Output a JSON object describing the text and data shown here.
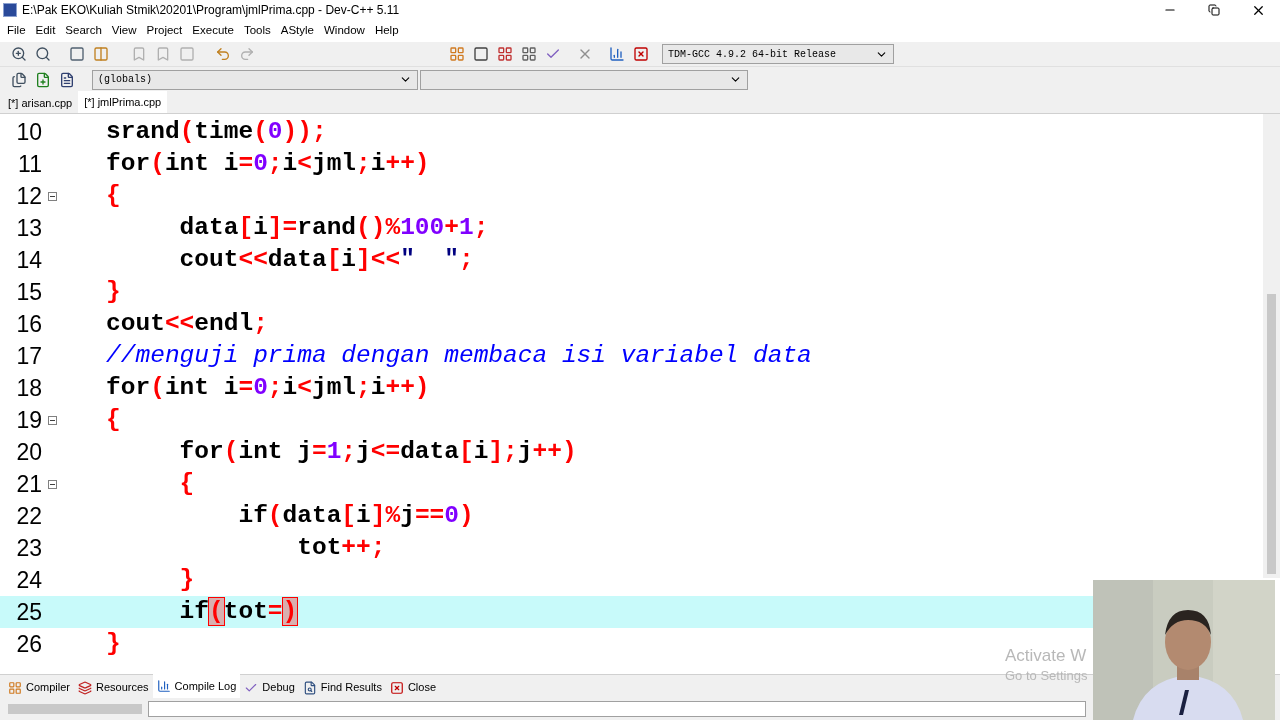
{
  "window": {
    "title": "E:\\Pak EKO\\Kuliah Stmik\\20201\\Program\\jmlPrima.cpp - Dev-C++ 5.11"
  },
  "menu": [
    "File",
    "Edit",
    "Search",
    "View",
    "Project",
    "Execute",
    "Tools",
    "AStyle",
    "Window",
    "Help"
  ],
  "compiler_select": {
    "value": "TDM-GCC 4.9.2 64-bit Release"
  },
  "scope_select": {
    "value": "(globals)"
  },
  "file_tabs": [
    {
      "label": "[*] arisan.cpp",
      "selected": false
    },
    {
      "label": "[*] jmlPrima.cpp",
      "selected": true
    }
  ],
  "editor": {
    "lines": [
      {
        "number": "10",
        "fold": false,
        "current": false,
        "tokens": [
          {
            "kind": "plain",
            "text": "   srand"
          },
          {
            "kind": "symbol",
            "text": "("
          },
          {
            "kind": "plain",
            "text": "time"
          },
          {
            "kind": "symbol",
            "text": "("
          },
          {
            "kind": "number",
            "text": "0"
          },
          {
            "kind": "symbol",
            "text": "));"
          }
        ]
      },
      {
        "number": "11",
        "fold": false,
        "current": false,
        "tokens": [
          {
            "kind": "keyword",
            "text": "   for"
          },
          {
            "kind": "symbol",
            "text": "("
          },
          {
            "kind": "keyword",
            "text": "int"
          },
          {
            "kind": "plain",
            "text": " i"
          },
          {
            "kind": "symbol",
            "text": "="
          },
          {
            "kind": "number",
            "text": "0"
          },
          {
            "kind": "symbol",
            "text": ";"
          },
          {
            "kind": "plain",
            "text": "i"
          },
          {
            "kind": "symbol",
            "text": "<"
          },
          {
            "kind": "plain",
            "text": "jml"
          },
          {
            "kind": "symbol",
            "text": ";"
          },
          {
            "kind": "plain",
            "text": "i"
          },
          {
            "kind": "symbol",
            "text": "++)"
          }
        ]
      },
      {
        "number": "12",
        "fold": true,
        "current": false,
        "tokens": [
          {
            "kind": "symbol",
            "text": "   {"
          }
        ]
      },
      {
        "number": "13",
        "fold": false,
        "current": false,
        "tokens": [
          {
            "kind": "plain",
            "text": "        data"
          },
          {
            "kind": "symbol",
            "text": "["
          },
          {
            "kind": "plain",
            "text": "i"
          },
          {
            "kind": "symbol",
            "text": "]="
          },
          {
            "kind": "plain",
            "text": "rand"
          },
          {
            "kind": "symbol",
            "text": "()%"
          },
          {
            "kind": "number",
            "text": "100"
          },
          {
            "kind": "symbol",
            "text": "+"
          },
          {
            "kind": "number",
            "text": "1"
          },
          {
            "kind": "symbol",
            "text": ";"
          }
        ]
      },
      {
        "number": "14",
        "fold": false,
        "current": false,
        "tokens": [
          {
            "kind": "plain",
            "text": "        cout"
          },
          {
            "kind": "symbol",
            "text": "<<"
          },
          {
            "kind": "plain",
            "text": "data"
          },
          {
            "kind": "symbol",
            "text": "["
          },
          {
            "kind": "plain",
            "text": "i"
          },
          {
            "kind": "symbol",
            "text": "]<<"
          },
          {
            "kind": "string",
            "text": "\"  \""
          },
          {
            "kind": "symbol",
            "text": ";"
          }
        ]
      },
      {
        "number": "15",
        "fold": false,
        "current": false,
        "tokens": [
          {
            "kind": "symbol",
            "text": "   }"
          }
        ]
      },
      {
        "number": "16",
        "fold": false,
        "current": false,
        "tokens": [
          {
            "kind": "plain",
            "text": "   cout"
          },
          {
            "kind": "symbol",
            "text": "<<"
          },
          {
            "kind": "plain",
            "text": "endl"
          },
          {
            "kind": "symbol",
            "text": ";"
          }
        ]
      },
      {
        "number": "17",
        "fold": false,
        "current": false,
        "tokens": [
          {
            "kind": "comment",
            "text": "   //menguji prima dengan membaca isi variabel data"
          }
        ]
      },
      {
        "number": "18",
        "fold": false,
        "current": false,
        "tokens": [
          {
            "kind": "keyword",
            "text": "   for"
          },
          {
            "kind": "symbol",
            "text": "("
          },
          {
            "kind": "keyword",
            "text": "int"
          },
          {
            "kind": "plain",
            "text": " i"
          },
          {
            "kind": "symbol",
            "text": "="
          },
          {
            "kind": "number",
            "text": "0"
          },
          {
            "kind": "symbol",
            "text": ";"
          },
          {
            "kind": "plain",
            "text": "i"
          },
          {
            "kind": "symbol",
            "text": "<"
          },
          {
            "kind": "plain",
            "text": "jml"
          },
          {
            "kind": "symbol",
            "text": ";"
          },
          {
            "kind": "plain",
            "text": "i"
          },
          {
            "kind": "symbol",
            "text": "++)"
          }
        ]
      },
      {
        "number": "19",
        "fold": true,
        "current": false,
        "tokens": [
          {
            "kind": "symbol",
            "text": "   {"
          }
        ]
      },
      {
        "number": "20",
        "fold": false,
        "current": false,
        "tokens": [
          {
            "kind": "keyword",
            "text": "        for"
          },
          {
            "kind": "symbol",
            "text": "("
          },
          {
            "kind": "keyword",
            "text": "int"
          },
          {
            "kind": "plain",
            "text": " j"
          },
          {
            "kind": "symbol",
            "text": "="
          },
          {
            "kind": "number",
            "text": "1"
          },
          {
            "kind": "symbol",
            "text": ";"
          },
          {
            "kind": "plain",
            "text": "j"
          },
          {
            "kind": "symbol",
            "text": "<="
          },
          {
            "kind": "plain",
            "text": "data"
          },
          {
            "kind": "symbol",
            "text": "["
          },
          {
            "kind": "plain",
            "text": "i"
          },
          {
            "kind": "symbol",
            "text": "];"
          },
          {
            "kind": "plain",
            "text": "j"
          },
          {
            "kind": "symbol",
            "text": "++)"
          }
        ]
      },
      {
        "number": "21",
        "fold": true,
        "current": false,
        "tokens": [
          {
            "kind": "symbol",
            "text": "        {"
          }
        ]
      },
      {
        "number": "22",
        "fold": false,
        "current": false,
        "tokens": [
          {
            "kind": "keyword",
            "text": "            if"
          },
          {
            "kind": "symbol",
            "text": "("
          },
          {
            "kind": "plain",
            "text": "data"
          },
          {
            "kind": "symbol",
            "text": "["
          },
          {
            "kind": "plain",
            "text": "i"
          },
          {
            "kind": "symbol",
            "text": "]%"
          },
          {
            "kind": "plain",
            "text": "j"
          },
          {
            "kind": "symbol",
            "text": "=="
          },
          {
            "kind": "number",
            "text": "0"
          },
          {
            "kind": "symbol",
            "text": ")"
          }
        ]
      },
      {
        "number": "23",
        "fold": false,
        "current": false,
        "tokens": [
          {
            "kind": "plain",
            "text": "                tot"
          },
          {
            "kind": "symbol",
            "text": "++;"
          }
        ]
      },
      {
        "number": "24",
        "fold": false,
        "current": false,
        "tokens": [
          {
            "kind": "symbol",
            "text": "        }"
          }
        ]
      },
      {
        "number": "25",
        "fold": false,
        "current": true,
        "tokens": [
          {
            "kind": "keyword",
            "text": "        if"
          },
          {
            "kind": "match",
            "text": "("
          },
          {
            "kind": "plain",
            "text": "tot"
          },
          {
            "kind": "symbol",
            "text": "="
          },
          {
            "kind": "match",
            "text": ")"
          }
        ]
      },
      {
        "number": "26",
        "fold": false,
        "current": false,
        "tokens": [
          {
            "kind": "symbol",
            "text": "   }"
          }
        ]
      }
    ]
  },
  "bottom_tabs": [
    {
      "label": "Compiler",
      "selected": false
    },
    {
      "label": "Resources",
      "selected": false
    },
    {
      "label": "Compile Log",
      "selected": true
    },
    {
      "label": "Debug",
      "selected": false
    },
    {
      "label": "Find Results",
      "selected": false
    },
    {
      "label": "Close",
      "selected": false
    }
  ],
  "activation_notice": {
    "title": "Activate W",
    "subtitle": "Go to Settings"
  }
}
